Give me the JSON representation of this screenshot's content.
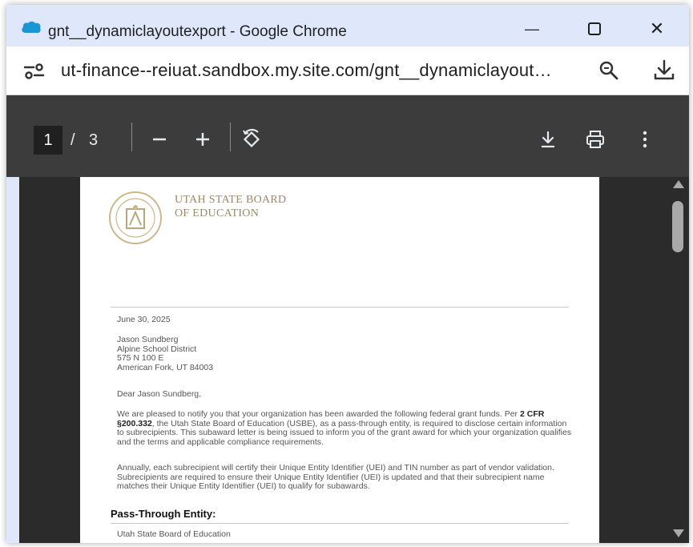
{
  "window": {
    "title": "gnt__dynamiclayoutexport - Google Chrome",
    "minimize_glyph": "—",
    "close_glyph": "✕"
  },
  "address_bar": {
    "url": "ut-finance--reiuat.sandbox.my.site.com/gnt__dynamiclayout…"
  },
  "pdf_toolbar": {
    "current_page": "1",
    "separator": "/",
    "total_pages": "3",
    "zoom_out_label": "−",
    "zoom_in_label": "+"
  },
  "document": {
    "org_name_line1": "UTAH STATE BOARD",
    "org_name_line2": "OF EDUCATION",
    "date": "June 30, 2025",
    "recipient_name": "Jason Sundberg",
    "recipient_org": "Alpine School District",
    "recipient_street": "575 N 100 E",
    "recipient_city": "American Fork, UT 84003",
    "salutation": "Dear Jason Sundberg,",
    "p1_a": "We are pleased to notify you that your organization has been awarded the following federal grant funds. Per ",
    "p1_bold1": "2",
    "p1_bold2": "CFR §200.332",
    "p1_b": ", the Utah State Board of Education (USBE), as a pass-through entity, is required to disclose certain information to subrecipients. This subaward letter is being issued to inform you of the grant award for which your organization qualifies and the terms and applicable compliance requirements.",
    "p2": "Annually, each subrecipient will certify their Unique Entity Identifier (UEI) and TIN number as part of vendor validation. Subrecipients are required to ensure their Unique Entity Identifier (UEI) is updated and that their subrecipient name matches their Unique Entity Identifier (UEI) to qualify for subawards.",
    "section_heading": "Pass-Through Entity:",
    "section_first_line": "Utah State Board of Education"
  },
  "icons": {
    "app": "salesforce-cloud-icon",
    "site_info": "tune-icon",
    "zoom": "zoom-icon",
    "download": "download-icon",
    "print": "print-icon",
    "more": "more-vert-icon",
    "rotate": "rotate-icon"
  },
  "colors": {
    "titlebar_bg": "#dfe8fb",
    "pdf_toolbar_bg": "#3c3c3c",
    "viewer_bg": "#2b2b2b",
    "seal_gold": "#b8a67c",
    "salesforce_blue": "#1b96d4"
  }
}
